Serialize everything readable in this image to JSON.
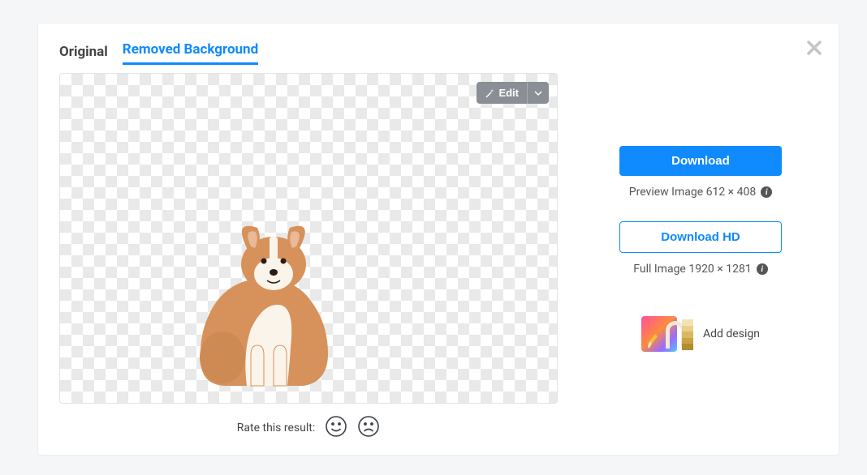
{
  "tabs": {
    "original": "Original",
    "removed": "Removed Background"
  },
  "edit": {
    "label": "Edit"
  },
  "rate": {
    "label": "Rate this result:"
  },
  "download": {
    "primary": "Download",
    "hd": "Download HD",
    "preview_meta": "Preview Image 612 × 408",
    "full_meta": "Full Image 1920 × 1281"
  },
  "design": {
    "label": "Add design"
  }
}
